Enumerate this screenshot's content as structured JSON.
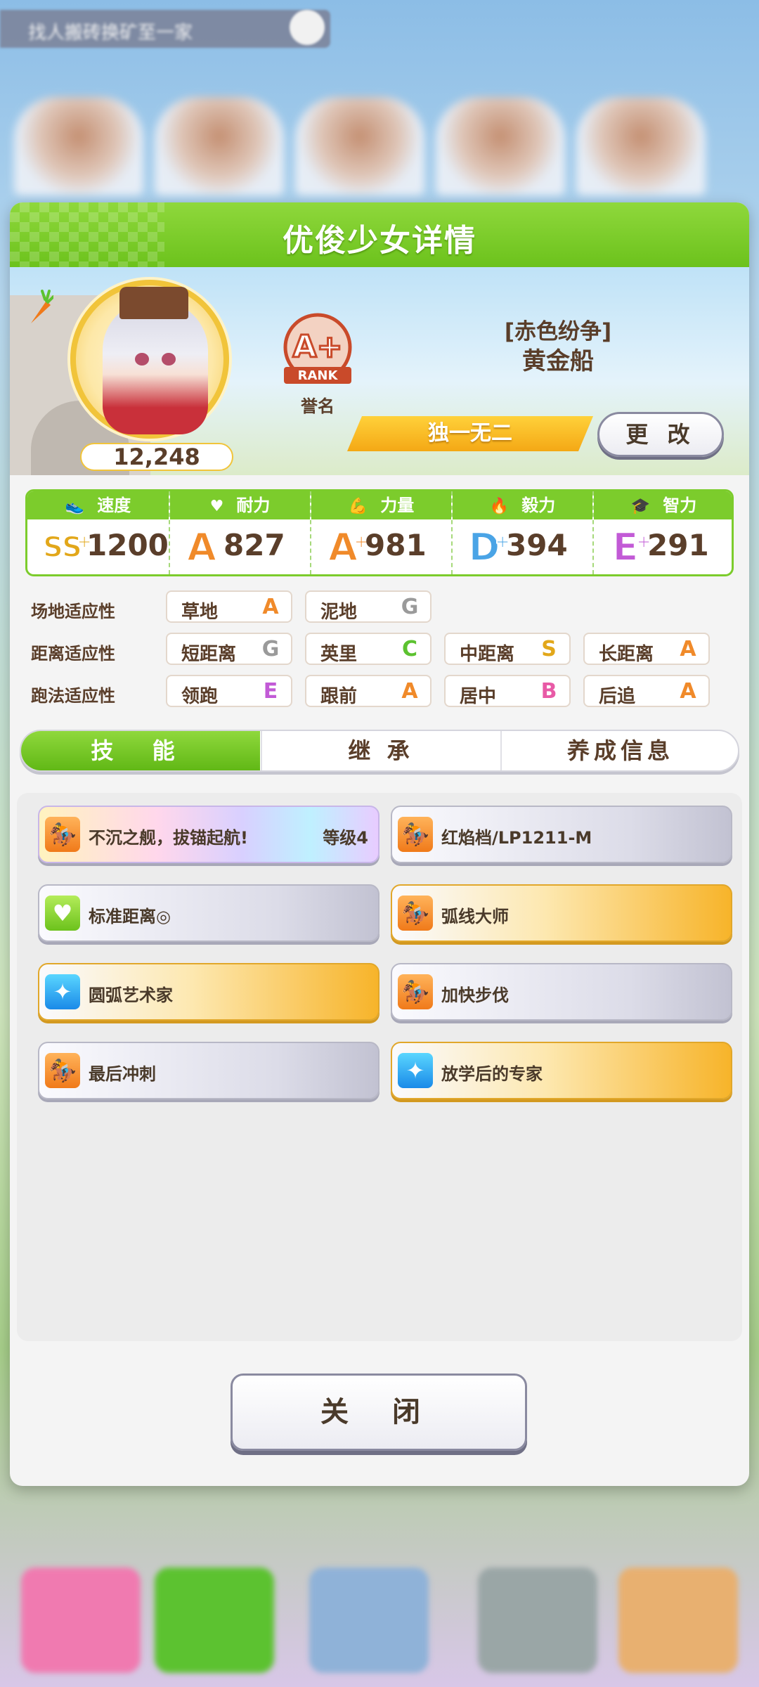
{
  "background": {
    "topbar_text": "找人搬砖换矿至一家"
  },
  "modal": {
    "title": "优俊少女详情",
    "hero": {
      "fans": "12,248",
      "rank_label": "誉名",
      "rank_text": "A+",
      "rank_sub": "RANK",
      "epithet": "[赤色纷争]",
      "name": "黄金船",
      "unique_banner": "独一无二",
      "change_button": "更 改"
    },
    "stats": [
      {
        "label": "速度",
        "icon": "shoe-icon",
        "grade": "SS",
        "plus": "+",
        "value": "1200",
        "color": "#e2a71a"
      },
      {
        "label": "耐力",
        "icon": "heart-icon",
        "grade": "A",
        "plus": "",
        "value": "827",
        "color": "#f08a2a"
      },
      {
        "label": "力量",
        "icon": "muscle-icon",
        "grade": "A",
        "plus": "+",
        "value": "981",
        "color": "#f08a2a"
      },
      {
        "label": "毅力",
        "icon": "flame-icon",
        "grade": "D",
        "plus": "+",
        "value": "394",
        "color": "#4aa4e6"
      },
      {
        "label": "智力",
        "icon": "graduation-cap-icon",
        "grade": "E",
        "plus": "+",
        "value": "291",
        "color": "#c25ad6"
      }
    ],
    "aptitudes": [
      {
        "label": "场地适应性",
        "cells": [
          {
            "name": "草地",
            "grade": "A",
            "color": "#f08a2a"
          },
          {
            "name": "泥地",
            "grade": "G",
            "color": "#9a9a9a"
          }
        ]
      },
      {
        "label": "距离适应性",
        "cells": [
          {
            "name": "短距离",
            "grade": "G",
            "color": "#9a9a9a"
          },
          {
            "name": "英里",
            "grade": "C",
            "color": "#5cc230"
          },
          {
            "name": "中距离",
            "grade": "S",
            "color": "#e2a71a"
          },
          {
            "name": "长距离",
            "grade": "A",
            "color": "#f08a2a"
          }
        ]
      },
      {
        "label": "跑法适应性",
        "cells": [
          {
            "name": "领跑",
            "grade": "E",
            "color": "#c25ad6"
          },
          {
            "name": "跟前",
            "grade": "A",
            "color": "#f08a2a"
          },
          {
            "name": "居中",
            "grade": "B",
            "color": "#e85aa6"
          },
          {
            "name": "后追",
            "grade": "A",
            "color": "#f08a2a"
          }
        ]
      }
    ],
    "tabs": [
      {
        "label": "技 能",
        "active": true
      },
      {
        "label": "继 承",
        "active": false
      },
      {
        "label": "养成信息",
        "active": false
      }
    ],
    "skills": [
      {
        "name": "不沉之舰，拔锚起航!",
        "level": "等级4",
        "style": "rainbow",
        "icon": "running-horse-icon",
        "icon_color": "orange"
      },
      {
        "name": "红焰档/LP1211-M",
        "level": "",
        "style": "gray",
        "icon": "running-horse-icon",
        "icon_color": "orange"
      },
      {
        "name": "标准距离◎",
        "level": "",
        "style": "gray",
        "icon": "heart-icon",
        "icon_color": "green"
      },
      {
        "name": "弧线大师",
        "level": "",
        "style": "gold",
        "icon": "running-horse-icon",
        "icon_color": "orange"
      },
      {
        "name": "圆弧艺术家",
        "level": "",
        "style": "gold",
        "icon": "sparkle-icon",
        "icon_color": "blue"
      },
      {
        "name": "加快步伐",
        "level": "",
        "style": "gray",
        "icon": "running-horse-icon",
        "icon_color": "orange"
      },
      {
        "name": "最后冲刺",
        "level": "",
        "style": "gray",
        "icon": "running-horse-icon",
        "icon_color": "orange"
      },
      {
        "name": "放学后的专家",
        "level": "",
        "style": "gold",
        "icon": "sparkle-icon",
        "icon_color": "blue"
      }
    ],
    "close_button": "关 闭"
  }
}
